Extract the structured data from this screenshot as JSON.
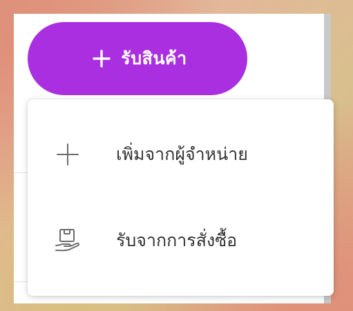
{
  "receive_button": {
    "label": "รับสินค้า",
    "icon": "plus-icon",
    "color": "#a92fe0"
  },
  "menu": {
    "items": [
      {
        "label": "เพิ่มจากผู้จำหน่าย",
        "icon": "plus-icon"
      },
      {
        "label": "รับจากการสั่งซื้อ",
        "icon": "receive-package-hand-icon"
      }
    ]
  }
}
